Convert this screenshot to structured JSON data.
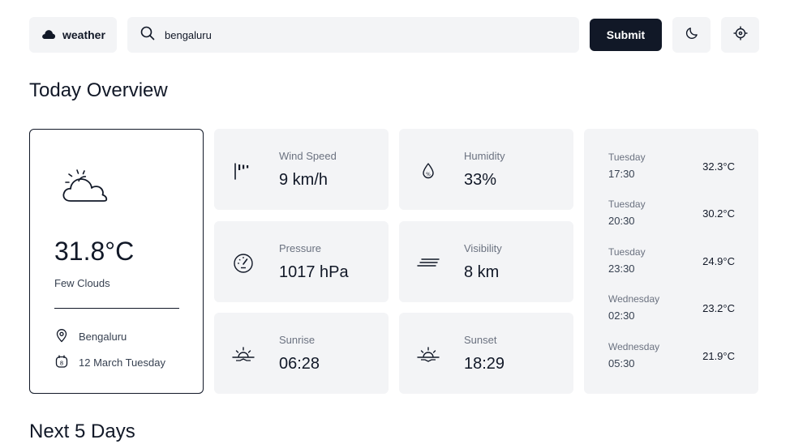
{
  "header": {
    "brand": "weather",
    "search_value": "bengaluru",
    "submit_label": "Submit"
  },
  "sections": {
    "today_title": "Today Overview",
    "next_title": "Next 5 Days"
  },
  "current": {
    "temperature": "31.8°C",
    "condition": "Few Clouds",
    "location": "Bengaluru",
    "date": "12 March Tuesday"
  },
  "stats": {
    "wind": {
      "label": "Wind Speed",
      "value": "9 km/h"
    },
    "humidity": {
      "label": "Humidity",
      "value": "33%"
    },
    "pressure": {
      "label": "Pressure",
      "value": "1017 hPa"
    },
    "visibility": {
      "label": "Visibility",
      "value": "8 km"
    },
    "sunrise": {
      "label": "Sunrise",
      "value": "06:28"
    },
    "sunset": {
      "label": "Sunset",
      "value": "18:29"
    }
  },
  "hourly": [
    {
      "day": "Tuesday",
      "time": "17:30",
      "temp": "32.3°C"
    },
    {
      "day": "Tuesday",
      "time": "20:30",
      "temp": "30.2°C"
    },
    {
      "day": "Tuesday",
      "time": "23:30",
      "temp": "24.9°C"
    },
    {
      "day": "Wednesday",
      "time": "02:30",
      "temp": "23.2°C"
    },
    {
      "day": "Wednesday",
      "time": "05:30",
      "temp": "21.9°C"
    }
  ],
  "icons": {
    "brand": "cloud-icon",
    "search": "search-icon",
    "theme": "moon-icon",
    "locate": "crosshair-icon"
  }
}
